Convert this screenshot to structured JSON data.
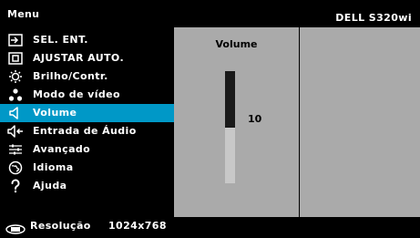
{
  "header": {
    "title": "Menu",
    "model": "DELL S320wi"
  },
  "menu": {
    "items": [
      {
        "label": "SEL. ENT.",
        "icon": "input-source-icon",
        "selected": false
      },
      {
        "label": "AJUSTAR AUTO.",
        "icon": "auto-adjust-icon",
        "selected": false
      },
      {
        "label": "Brilho/Contr.",
        "icon": "brightness-icon",
        "selected": false
      },
      {
        "label": "Modo de vídeo",
        "icon": "video-mode-icon",
        "selected": false
      },
      {
        "label": "Volume",
        "icon": "speaker-icon",
        "selected": true
      },
      {
        "label": "Entrada de Áudio",
        "icon": "audio-input-icon",
        "selected": false
      },
      {
        "label": "Avançado",
        "icon": "sliders-icon",
        "selected": false
      },
      {
        "label": "Idioma",
        "icon": "language-icon",
        "selected": false
      },
      {
        "label": "Ajuda",
        "icon": "help-icon",
        "selected": false
      }
    ]
  },
  "volume": {
    "title": "Volume",
    "value": "10",
    "level": 0.5
  },
  "status": {
    "label": "Resolução",
    "value": "1024x768",
    "icon": "display-icon"
  },
  "colors": {
    "highlight": "#0098c7",
    "panel": "#aaaaaa",
    "background": "#000000"
  }
}
